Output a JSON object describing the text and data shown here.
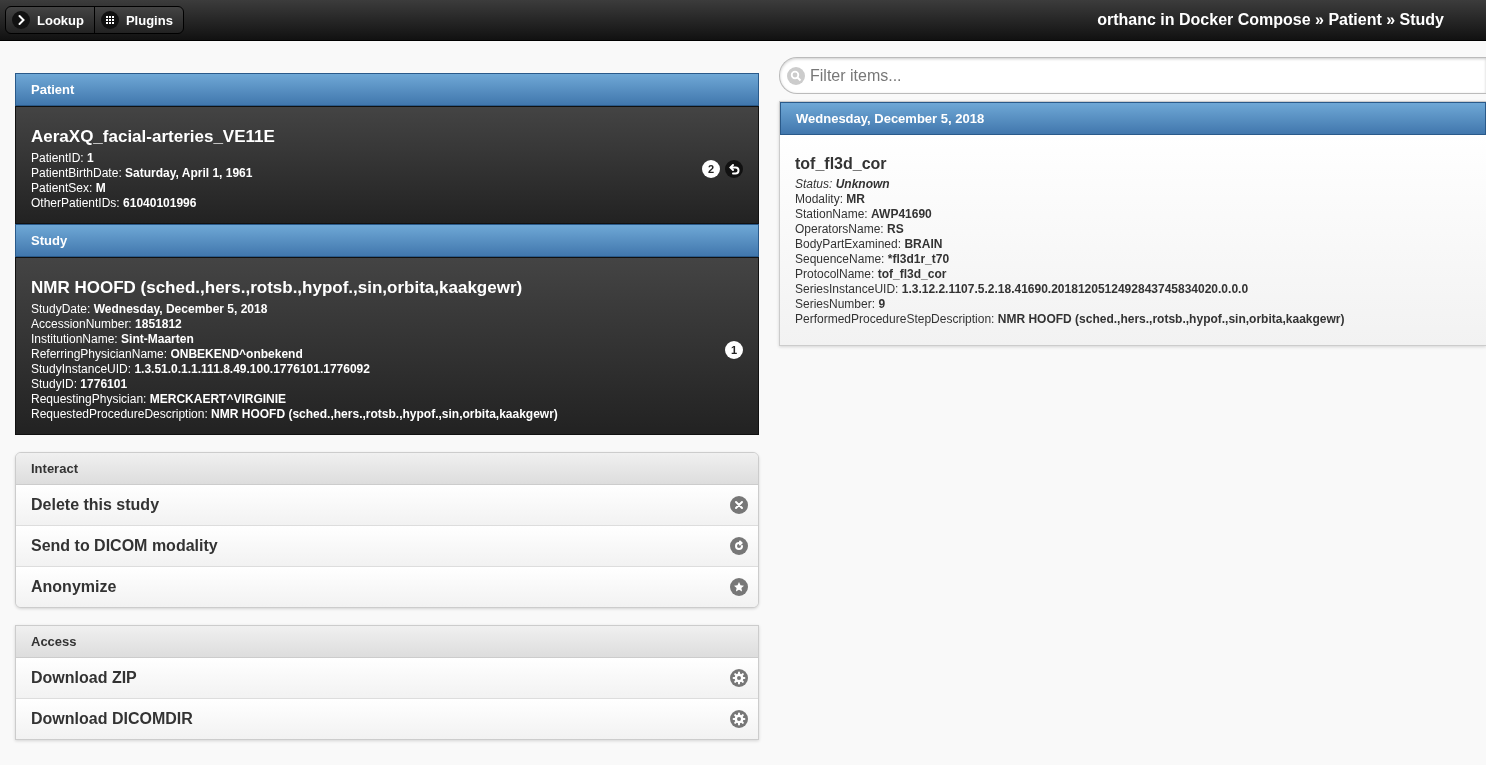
{
  "header": {
    "buttons": [
      {
        "label": "Lookup",
        "kind": "chevron"
      },
      {
        "label": "Plugins",
        "kind": "grid"
      }
    ],
    "breadcrumb": "orthanc in Docker Compose » Patient » Study"
  },
  "patient": {
    "heading": "Patient",
    "name": "AeraXQ_facial-arteries_VE11E",
    "fields": [
      {
        "label": "PatientID: ",
        "value": "1"
      },
      {
        "label": "PatientBirthDate: ",
        "value": "Saturday, April 1, 1961"
      },
      {
        "label": "PatientSex: ",
        "value": "M"
      },
      {
        "label": "OtherPatientIDs: ",
        "value": "61040101996"
      }
    ],
    "count": "2"
  },
  "study": {
    "heading": "Study",
    "name": "NMR HOOFD (sched.,hers.,rotsb.,hypof.,sin,orbita,kaakgewr)",
    "fields": [
      {
        "label": "StudyDate: ",
        "value": "Wednesday, December 5, 2018"
      },
      {
        "label": "AccessionNumber: ",
        "value": "1851812"
      },
      {
        "label": "InstitutionName: ",
        "value": "Sint-Maarten"
      },
      {
        "label": "ReferringPhysicianName: ",
        "value": "ONBEKEND^onbekend"
      },
      {
        "label": "StudyInstanceUID: ",
        "value": "1.3.51.0.1.1.111.8.49.100.1776101.1776092"
      },
      {
        "label": "StudyID: ",
        "value": "1776101"
      },
      {
        "label": "RequestingPhysician: ",
        "value": "MERCKAERT^VIRGINIE"
      },
      {
        "label": "RequestedProcedureDescription: ",
        "value": "NMR HOOFD (sched.,hers.,rotsb.,hypof.,sin,orbita,kaakgewr)"
      }
    ],
    "count": "1"
  },
  "interact": {
    "heading": "Interact",
    "items": [
      {
        "label": "Delete this study",
        "kind": "delete"
      },
      {
        "label": "Send to DICOM modality",
        "kind": "forward"
      },
      {
        "label": "Anonymize",
        "kind": "star"
      }
    ]
  },
  "access": {
    "heading": "Access",
    "items": [
      {
        "label": "Download ZIP",
        "kind": "gear"
      },
      {
        "label": "Download DICOMDIR",
        "kind": "gear"
      }
    ]
  },
  "series": {
    "search": {
      "placeholder": "Filter items..."
    },
    "date_heading": "Wednesday, December 5, 2018",
    "items": [
      {
        "name": "tof_fl3d_cor",
        "status_label": "Status: ",
        "status": "Unknown",
        "fields": [
          {
            "label": "Modality: ",
            "value": "MR"
          },
          {
            "label": "StationName: ",
            "value": "AWP41690"
          },
          {
            "label": "OperatorsName: ",
            "value": "RS"
          },
          {
            "label": "BodyPartExamined: ",
            "value": "BRAIN"
          },
          {
            "label": "SequenceName: ",
            "value": "*fl3d1r_t70"
          },
          {
            "label": "ProtocolName: ",
            "value": "tof_fl3d_cor"
          },
          {
            "label": "SeriesInstanceUID: ",
            "value": "1.3.12.2.1107.5.2.18.41690.2018120512492843745834020.0.0.0"
          },
          {
            "label": "SeriesNumber: ",
            "value": "9"
          },
          {
            "label": "PerformedProcedureStepDescription: ",
            "value": "NMR HOOFD (sched.,hers.,rotsb.,hypof.,sin,orbita,kaakgewr)"
          }
        ]
      }
    ]
  }
}
